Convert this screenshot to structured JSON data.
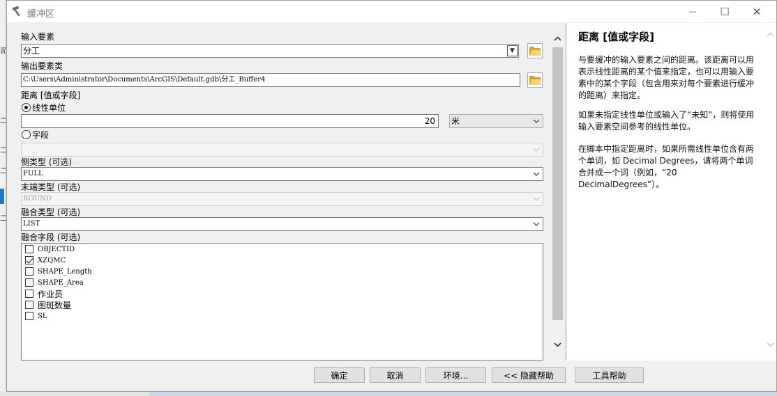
{
  "window": {
    "title": "缓冲区",
    "controls": {
      "minimize": "—",
      "maximize": "☐",
      "close": "✕"
    }
  },
  "background": {
    "marks": [
      "司",
      "二",
      "二",
      "二",
      "二"
    ]
  },
  "form": {
    "input_features": {
      "label": "输入要素",
      "value": "分工"
    },
    "output_feature_class": {
      "label": "输出要素类",
      "value": "C:\\Users\\Administrator\\Documents\\ArcGIS\\Default.gdb\\分工_Buffer4"
    },
    "distance": {
      "label": "距离 [值或字段]",
      "linear_unit": {
        "label": "线性单位",
        "selected": true,
        "value": "20",
        "unit": "米"
      },
      "field": {
        "label": "字段",
        "selected": false,
        "value": ""
      }
    },
    "side_type": {
      "label": "侧类型 (可选)",
      "value": "FULL"
    },
    "end_type": {
      "label": "末端类型 (可选)",
      "value": "ROUND",
      "disabled": true
    },
    "dissolve_type": {
      "label": "融合类型 (可选)",
      "value": "LIST"
    },
    "dissolve_fields": {
      "label": "融合字段 (可选)",
      "items": [
        {
          "name": "OBJECTID",
          "checked": false
        },
        {
          "name": "XZQMC",
          "checked": true
        },
        {
          "name": "SHAPE_Length",
          "checked": false
        },
        {
          "name": "SHAPE_Area",
          "checked": false
        },
        {
          "name": "作业员",
          "checked": false
        },
        {
          "name": "图斑数量",
          "checked": false
        },
        {
          "name": "SL",
          "checked": false
        }
      ]
    }
  },
  "help": {
    "title": "距离 [值或字段]",
    "paragraphs": [
      "与要缓冲的输入要素之间的距离。该距离可以用表示线性距离的某个值来指定，也可以用输入要素中的某个字段（包含用来对每个要素进行缓冲的距离）来指定。",
      "如果未指定线性单位或输入了“未知”，则将使用输入要素空间参考的线性单位。",
      "在脚本中指定距离时，如果所需线性单位含有两个单词，如 Decimal Degrees，请将两个单词合并成一个词（例如，“20 DecimalDegrees”）。"
    ]
  },
  "buttons": {
    "ok": "确定",
    "cancel": "取消",
    "environments": "环境...",
    "hide_help": "<< 隐藏帮助",
    "tool_help": "工具帮助"
  },
  "icons": {
    "title": "hammer-icon",
    "folder": "folder-icon",
    "dropdown": "chevron-down-icon",
    "scroll_up": "chevron-up-icon",
    "scroll_down": "chevron-down-icon"
  },
  "colors": {
    "window_bg": "#f0f0f0",
    "field_border": "#7a7a7a",
    "button_bg": "#e1e1e1",
    "disabled_text": "#a0a0a0"
  }
}
